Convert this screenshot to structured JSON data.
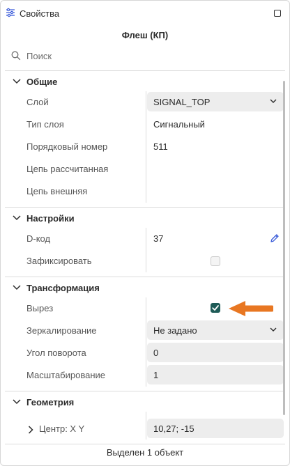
{
  "window": {
    "title": "Свойства"
  },
  "object": {
    "title": "Флеш (КП)"
  },
  "search": {
    "placeholder": "Поиск"
  },
  "sections": {
    "general": {
      "title": "Общие",
      "layer_label": "Слой",
      "layer_value": "SIGNAL_TOP",
      "layer_type_label": "Тип слоя",
      "layer_type_value": "Сигнальный",
      "order_label": "Порядковый номер",
      "order_value": "511",
      "calc_net_label": "Цепь рассчитанная",
      "ext_net_label": "Цепь внешняя"
    },
    "settings": {
      "title": "Настройки",
      "dcode_label": "D-код",
      "dcode_value": "37",
      "fix_label": "Зафиксировать",
      "fix_checked": false
    },
    "transform": {
      "title": "Трансформация",
      "cutout_label": "Вырез",
      "cutout_checked": true,
      "mirror_label": "Зеркалирование",
      "mirror_value": "Не задано",
      "rotation_label": "Угол поворота",
      "rotation_value": "0",
      "scale_label": "Масштабирование",
      "scale_value": "1"
    },
    "geometry": {
      "title": "Геометрия",
      "center_label": "Центр: X Y",
      "center_value": "10,27; -15"
    }
  },
  "footer": {
    "status": "Выделен 1 объект"
  },
  "colors": {
    "accent": "#1e5b57",
    "arrow": "#e87722",
    "pencil": "#3a5bd9"
  }
}
